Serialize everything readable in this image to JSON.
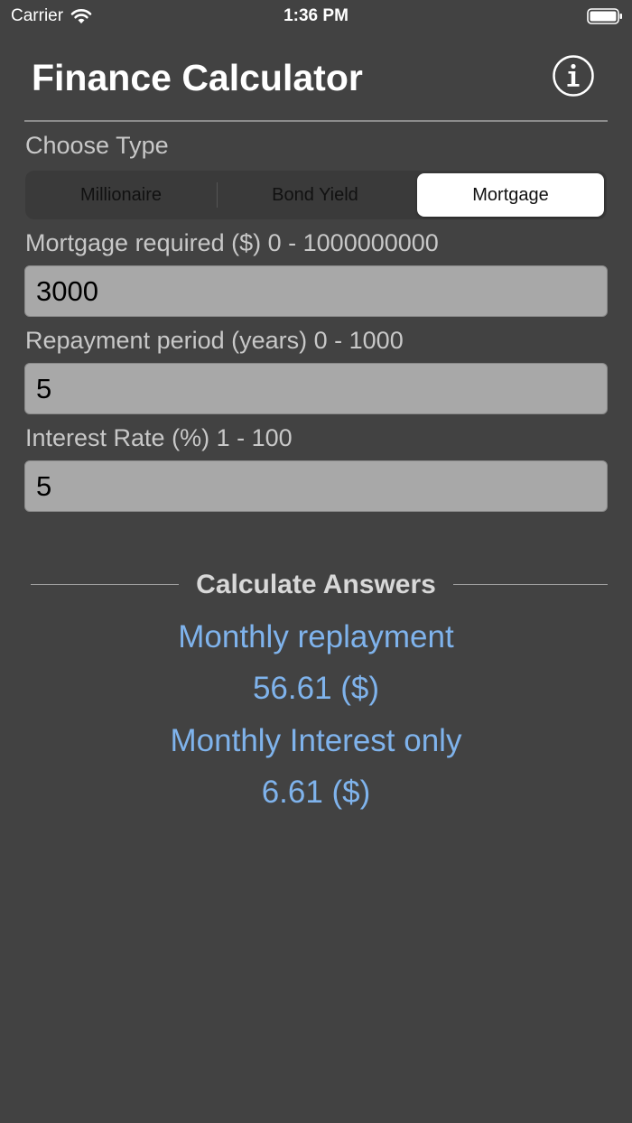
{
  "status_bar": {
    "carrier": "Carrier",
    "time": "1:36 PM"
  },
  "header": {
    "title": "Finance Calculator",
    "info_icon": "info-circle-icon"
  },
  "type_selector": {
    "label": "Choose Type",
    "options": [
      "Millionaire",
      "Bond Yield",
      "Mortgage"
    ],
    "selected": "Mortgage"
  },
  "form": {
    "mortgage_label": "Mortgage required ($) 0 - 1000000000",
    "mortgage_value": "3000",
    "period_label": "Repayment period (years) 0 - 1000",
    "period_value": "5",
    "rate_label": "Interest Rate (%) 1 - 100",
    "rate_value": "5"
  },
  "results": {
    "heading": "Calculate Answers",
    "monthly_repayment_label": "Monthly replayment",
    "monthly_repayment_value": "56.61 ($)",
    "monthly_interest_label": "Monthly Interest only",
    "monthly_interest_value": "6.61 ($)"
  },
  "colors": {
    "background": "#424242",
    "result_text": "#7fb3ec",
    "field_background": "#a8a8a8"
  }
}
